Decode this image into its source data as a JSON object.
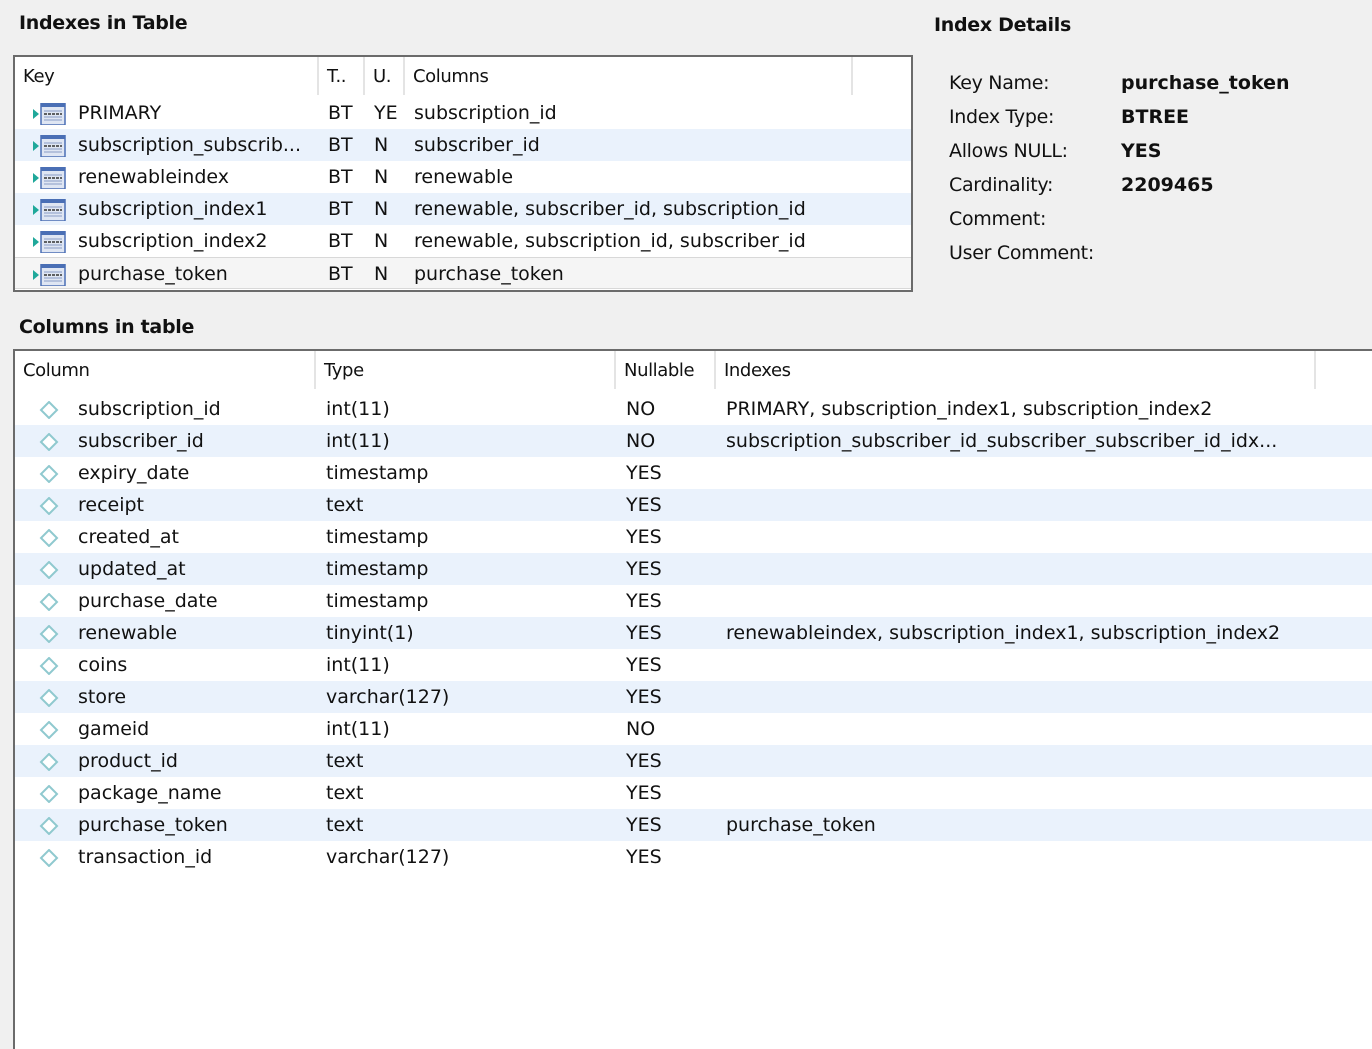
{
  "indexes_section": {
    "title": "Indexes in Table",
    "headers": [
      "Key",
      "T..",
      "U.",
      "Columns",
      ""
    ],
    "rows": [
      {
        "key": "PRIMARY",
        "type": "BT",
        "unique": "YE",
        "columns": "subscription_id",
        "icon": "index-icon"
      },
      {
        "key": "subscription_subscrib...",
        "type": "BT",
        "unique": "N",
        "columns": "subscriber_id",
        "icon": "index-icon"
      },
      {
        "key": "renewableindex",
        "type": "BT",
        "unique": "N",
        "columns": "renewable",
        "icon": "index-icon"
      },
      {
        "key": "subscription_index1",
        "type": "BT",
        "unique": "N",
        "columns": "renewable, subscriber_id, subscription_id",
        "icon": "index-icon"
      },
      {
        "key": "subscription_index2",
        "type": "BT",
        "unique": "N",
        "columns": "renewable, subscription_id, subscriber_id",
        "icon": "index-icon"
      },
      {
        "key": "purchase_token",
        "type": "BT",
        "unique": "N",
        "columns": "purchase_token",
        "icon": "index-icon",
        "selected": true
      }
    ]
  },
  "index_details": {
    "title": "Index Details",
    "fields": [
      {
        "label": "Key Name:",
        "value": "purchase_token"
      },
      {
        "label": "Index Type:",
        "value": "BTREE"
      },
      {
        "label": "Allows NULL:",
        "value": "YES"
      },
      {
        "label": "Cardinality:",
        "value": "2209465"
      },
      {
        "label": "Comment:",
        "value": ""
      },
      {
        "label": "User Comment:",
        "value": ""
      }
    ]
  },
  "columns_section": {
    "title": "Columns in table",
    "headers": [
      "Column",
      "Type",
      "Nullable",
      "Indexes",
      ""
    ],
    "rows": [
      {
        "column": "subscription_id",
        "type": "int(11)",
        "nullable": "NO",
        "indexes": "PRIMARY, subscription_index1, subscription_index2"
      },
      {
        "column": "subscriber_id",
        "type": "int(11)",
        "nullable": "NO",
        "indexes": "subscription_subscriber_id_subscriber_subscriber_id_idx..."
      },
      {
        "column": "expiry_date",
        "type": "timestamp",
        "nullable": "YES",
        "indexes": ""
      },
      {
        "column": "receipt",
        "type": "text",
        "nullable": "YES",
        "indexes": ""
      },
      {
        "column": "created_at",
        "type": "timestamp",
        "nullable": "YES",
        "indexes": ""
      },
      {
        "column": "updated_at",
        "type": "timestamp",
        "nullable": "YES",
        "indexes": ""
      },
      {
        "column": "purchase_date",
        "type": "timestamp",
        "nullable": "YES",
        "indexes": ""
      },
      {
        "column": "renewable",
        "type": "tinyint(1)",
        "nullable": "YES",
        "indexes": "renewableindex, subscription_index1, subscription_index2"
      },
      {
        "column": "coins",
        "type": "int(11)",
        "nullable": "YES",
        "indexes": ""
      },
      {
        "column": "store",
        "type": "varchar(127)",
        "nullable": "YES",
        "indexes": ""
      },
      {
        "column": "gameid",
        "type": "int(11)",
        "nullable": "NO",
        "indexes": ""
      },
      {
        "column": "product_id",
        "type": "text",
        "nullable": "YES",
        "indexes": ""
      },
      {
        "column": "package_name",
        "type": "text",
        "nullable": "YES",
        "indexes": ""
      },
      {
        "column": "purchase_token",
        "type": "text",
        "nullable": "YES",
        "indexes": "purchase_token"
      },
      {
        "column": "transaction_id",
        "type": "varchar(127)",
        "nullable": "YES",
        "indexes": ""
      }
    ]
  },
  "colors": {
    "row_alt": "#eaf2fc",
    "selected_row": "#f5f5f5",
    "border": "#6b6b6b",
    "index_icon_blue": "#4a6fb5",
    "index_icon_arrow": "#1fa89a",
    "column_icon": "#8fc9cf"
  }
}
